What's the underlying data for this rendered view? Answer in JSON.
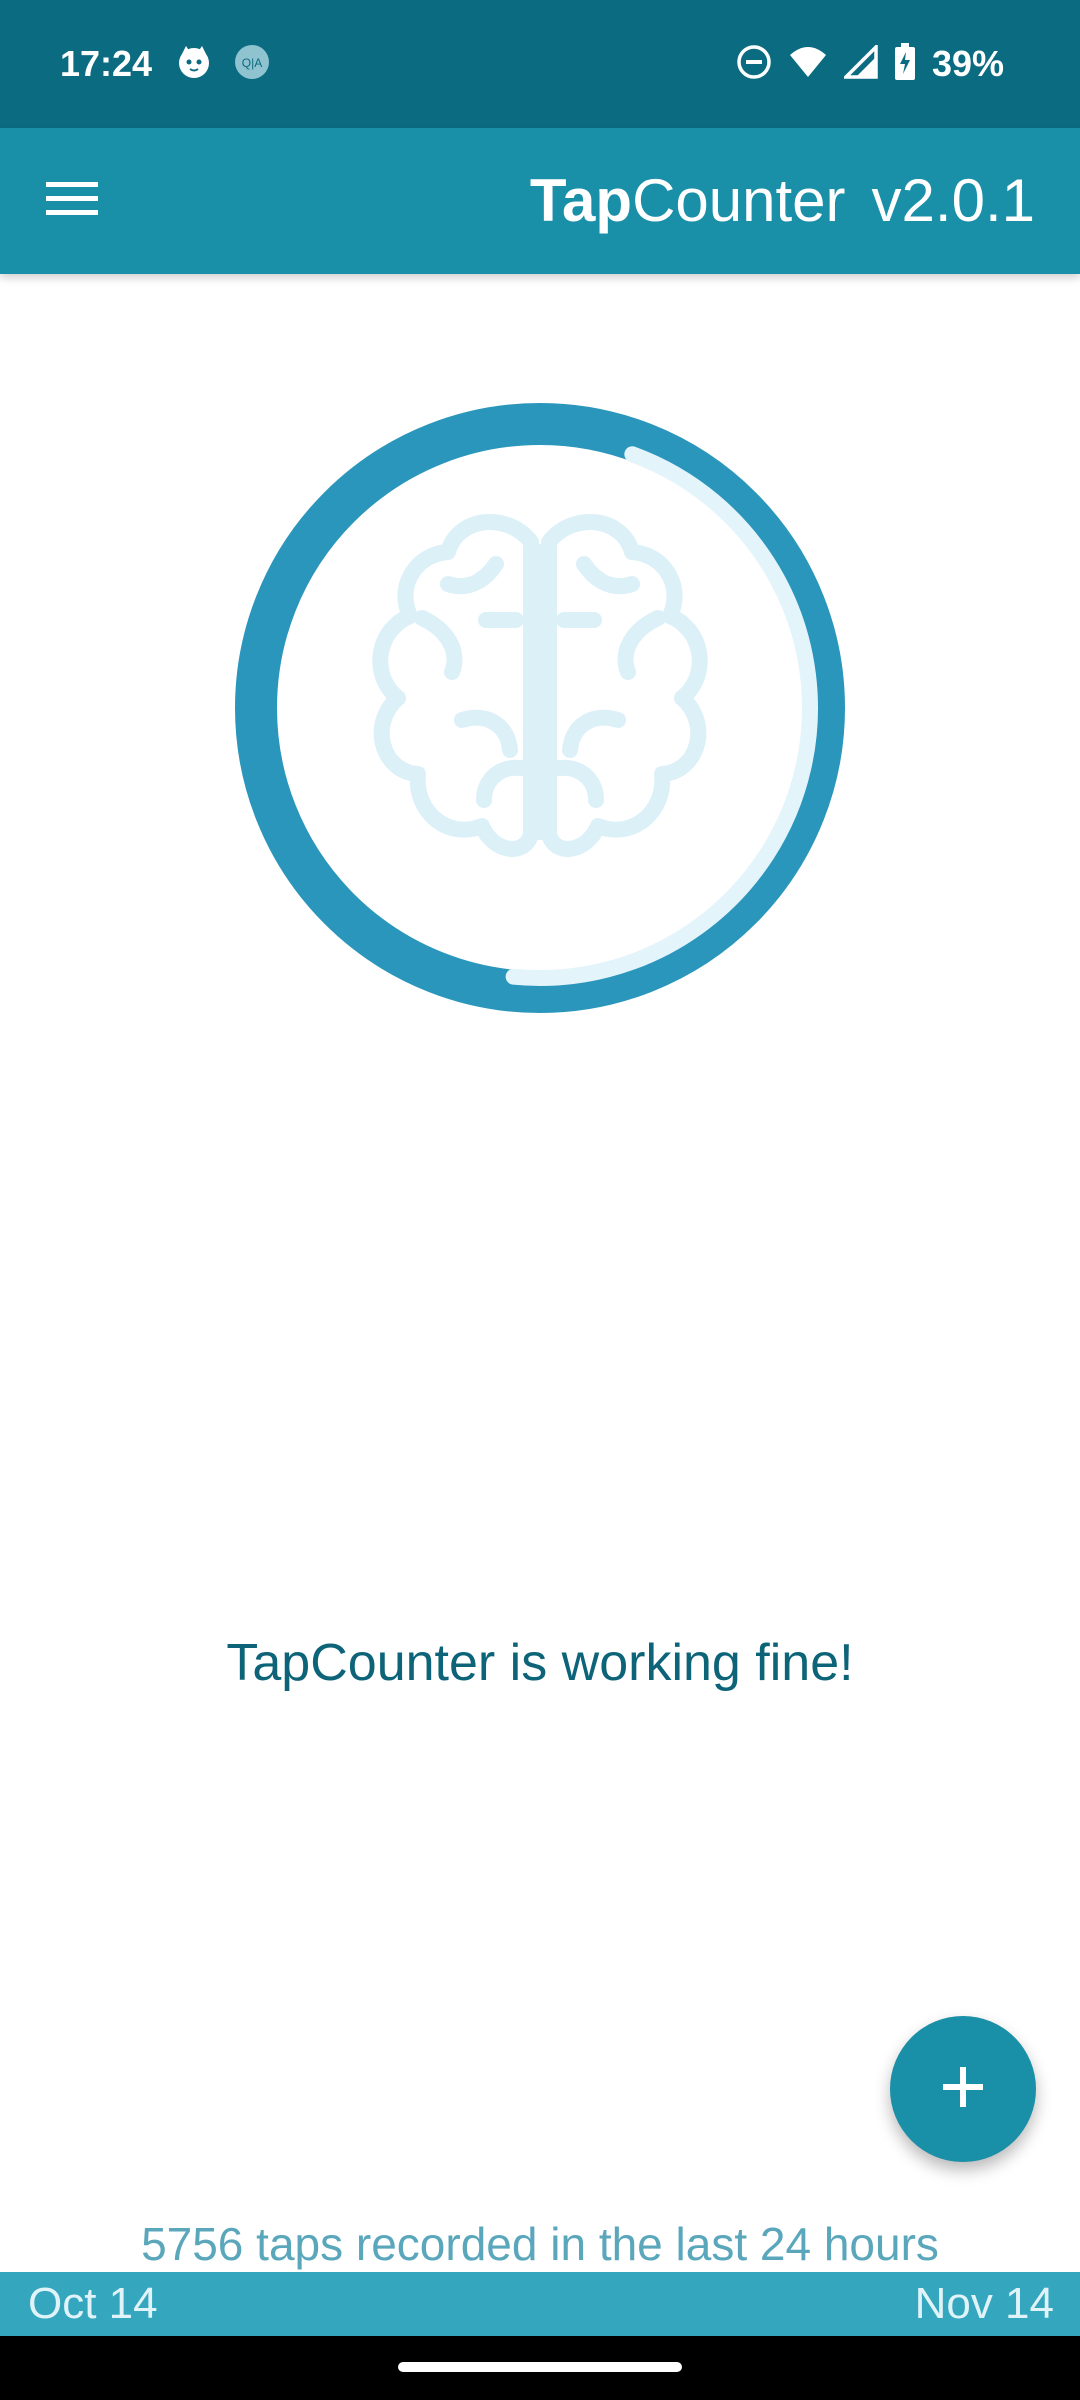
{
  "status_bar": {
    "time": "17:24",
    "battery": "39%",
    "icons": [
      "cat-notification-icon",
      "qa-notification-icon",
      "do-not-disturb-icon",
      "wifi-icon",
      "signal-icon",
      "battery-charging-icon"
    ]
  },
  "app_bar": {
    "title_bold": "Tap",
    "title_rest": "Counter",
    "version": "v2.0.1",
    "menu_icon": "hamburger-menu-icon"
  },
  "hero": {
    "icon": "brain-icon",
    "ring_progress": 0.46
  },
  "status_message": "TapCounter is working fine!",
  "fab": {
    "icon": "plus-icon"
  },
  "summary": "5756 taps recorded in the last 24 hours",
  "timeline": {
    "start": "Oct 14",
    "end": "Nov 14"
  },
  "colors": {
    "status_bar": "#0b6b80",
    "app_bar": "#1a8fa8",
    "ring": "#2a96bb",
    "ring_track": "#e3f4fb",
    "brain": "#dcf0f8",
    "message_text": "#0d6478",
    "timeline_bar": "#34a6bd"
  }
}
